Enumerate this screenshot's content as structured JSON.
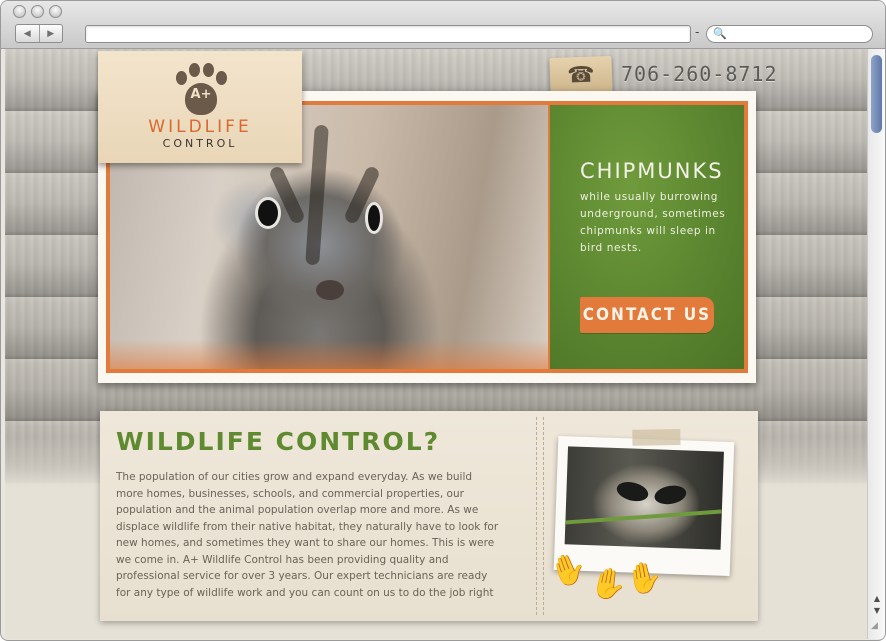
{
  "browser": {
    "back_icon": "◀",
    "forward_icon": "▶",
    "dash": "-",
    "search_icon": "🔍"
  },
  "header": {
    "phone_icon": "☎",
    "phone": "706-260-8712"
  },
  "logo": {
    "badge": "A+",
    "word1": "WILDLIFE",
    "word2": "CONTROL"
  },
  "hero": {
    "title": "CHIPMUNKS",
    "text": "while usually burrowing underground, sometimes chipmunks will sleep in bird nests.",
    "cta": "CONTACT US"
  },
  "info": {
    "title": "WILDLIFE CONTROL?",
    "body": "The population of our cities grow and expand everyday. As we build more homes, businesses, schools, and commercial properties, our population and the animal population overlap more and more. As we displace wildlife from their native habitat, they naturally have to look for new homes, and sometimes they want to share our homes. This is were we come in. A+ Wildlife Control has been providing quality and professional service for over 3 years. Our expert technicians are ready for any type of wildlife work and you can count on us to do the job right"
  },
  "colors": {
    "accent_orange": "#e27a3c",
    "accent_green": "#5f8a30"
  }
}
